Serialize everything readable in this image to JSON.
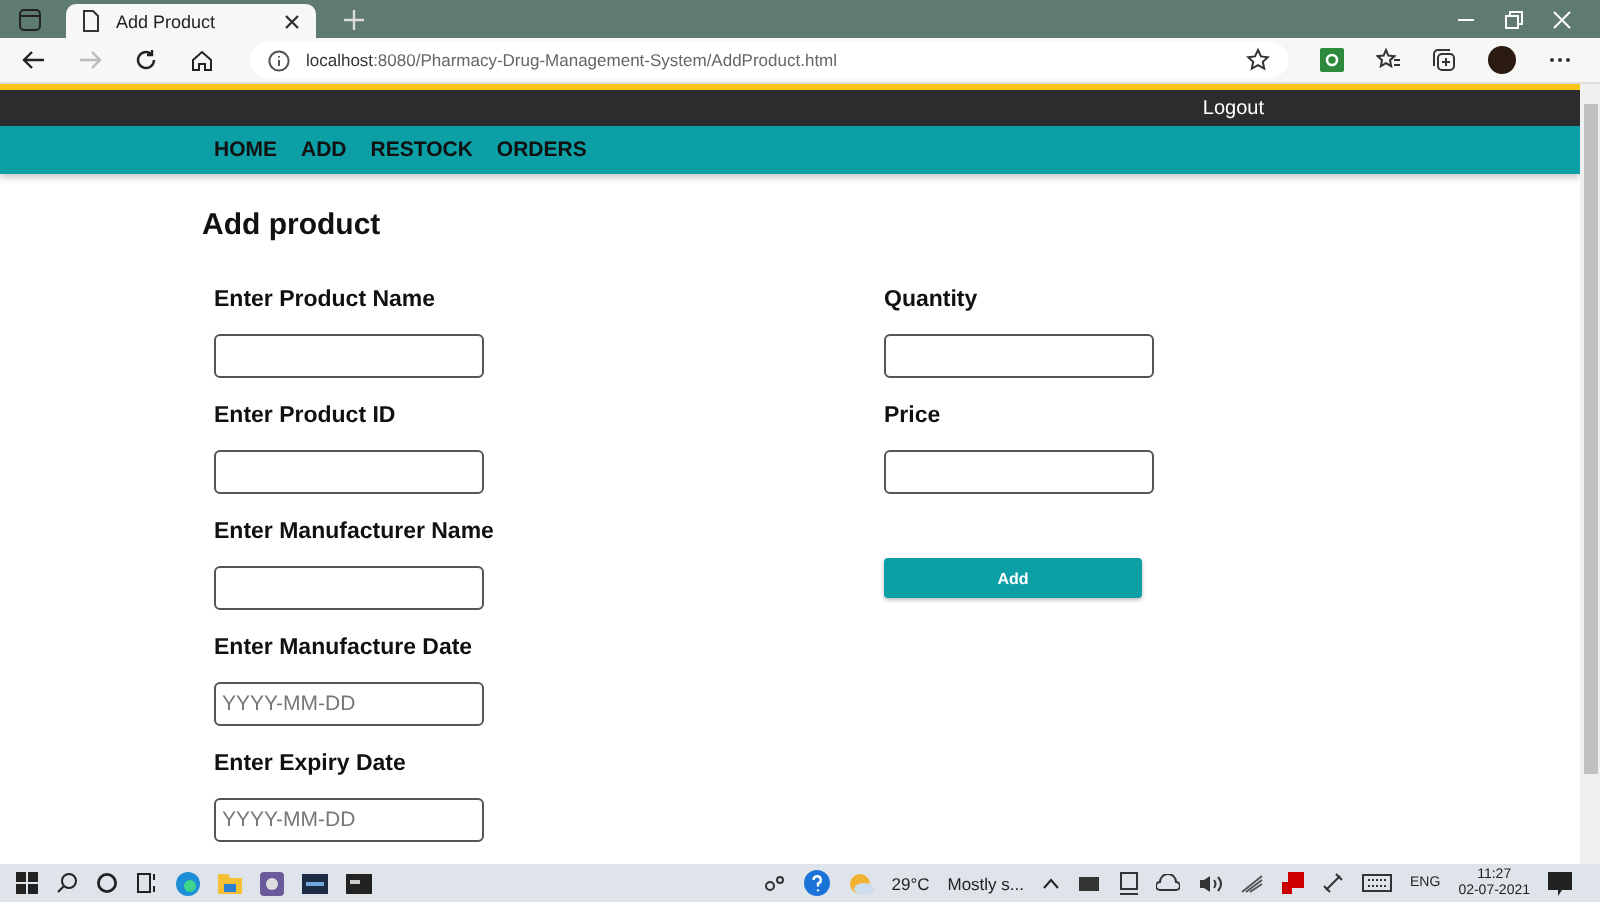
{
  "browser": {
    "tab_title": "Add Product",
    "url_host": "localhost",
    "url_rest": ":8080/Pharmacy-Drug-Management-System/AddProduct.html"
  },
  "top_bar": {
    "logout": "Logout"
  },
  "nav": [
    {
      "label": "HOME"
    },
    {
      "label": "ADD"
    },
    {
      "label": "RESTOCK"
    },
    {
      "label": "ORDERS"
    }
  ],
  "heading": "Add product",
  "left_fields": [
    {
      "label": "Enter Product Name"
    },
    {
      "label": "Enter Product ID"
    },
    {
      "label": "Enter Manufacturer Name"
    },
    {
      "label": "Enter Manufacture Date",
      "placeholder": "YYYY-MM-DD"
    },
    {
      "label": "Enter Expiry Date",
      "placeholder": "YYYY-MM-DD"
    }
  ],
  "right_fields": [
    {
      "label": "Quantity"
    },
    {
      "label": "Price"
    }
  ],
  "add_button": "Add",
  "taskbar": {
    "temperature": "29°C",
    "weather": "Mostly s...",
    "language": "ENG",
    "time": "11:27",
    "date": "02-07-2021"
  }
}
